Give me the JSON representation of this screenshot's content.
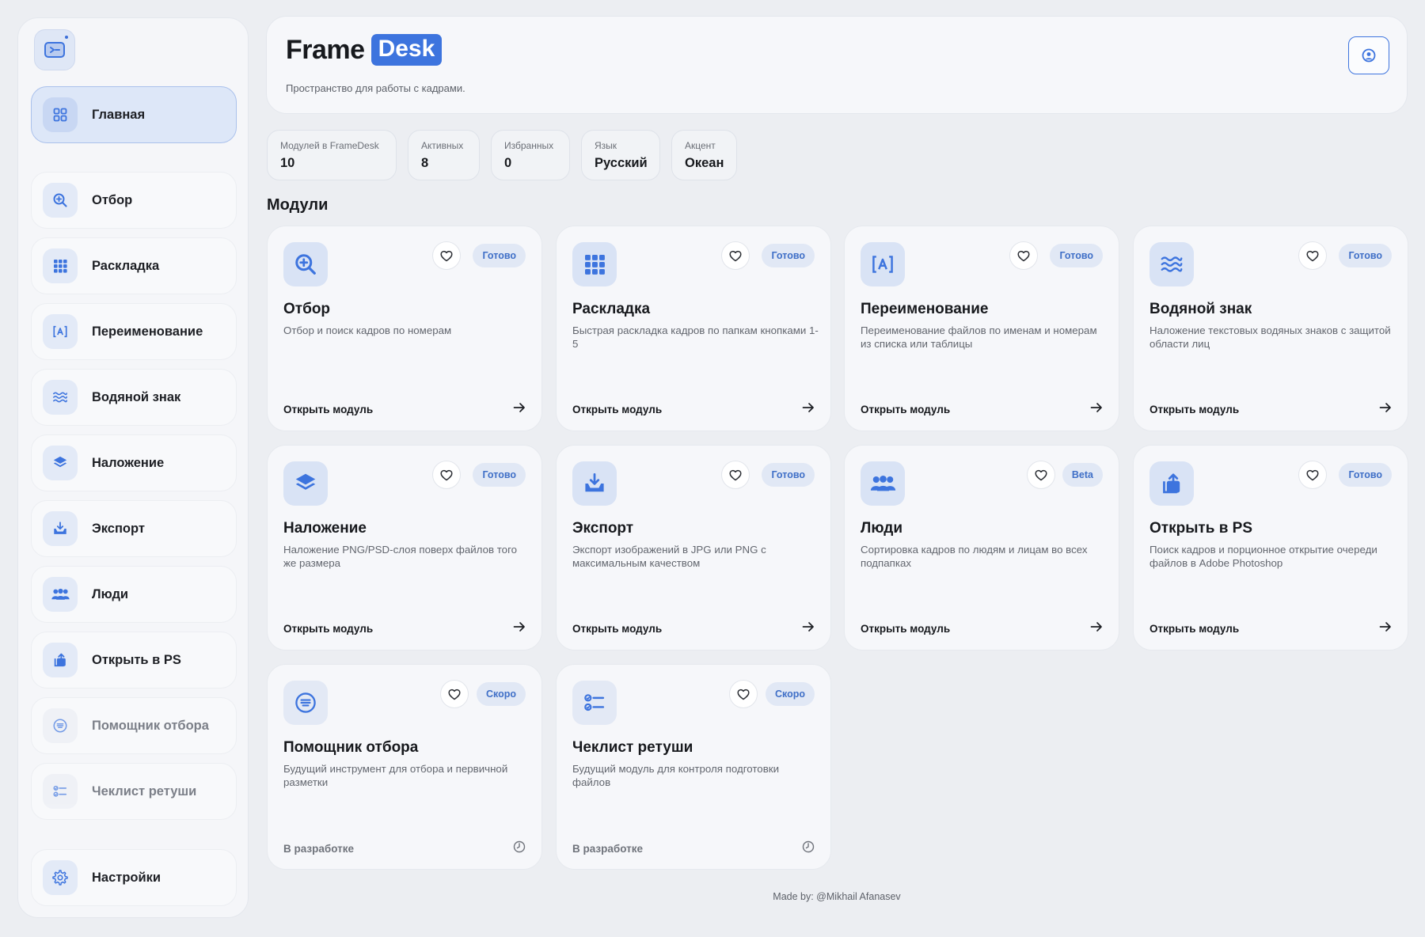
{
  "brand": {
    "word": "Frame",
    "badge": "Desk"
  },
  "header": {
    "subtitle": "Пространство для работы с кадрами."
  },
  "accent_color": "#3d74de",
  "sidebar": {
    "items": [
      {
        "label": "Главная",
        "icon": "grid-icon",
        "active": true
      },
      {
        "label": "Отбор",
        "icon": "zoom-in-icon"
      },
      {
        "label": "Раскладка",
        "icon": "dots-grid-icon"
      },
      {
        "label": "Переименование",
        "icon": "rename-icon"
      },
      {
        "label": "Водяной знак",
        "icon": "waves-icon"
      },
      {
        "label": "Наложение",
        "icon": "layers-icon"
      },
      {
        "label": "Экспорт",
        "icon": "export-tray-icon"
      },
      {
        "label": "Люди",
        "icon": "people-icon"
      },
      {
        "label": "Открыть в PS",
        "icon": "open-external-icon"
      },
      {
        "label": "Помощник отбора",
        "icon": "list-circle-icon",
        "disabled": true
      },
      {
        "label": "Чеклист ретуши",
        "icon": "checklist-icon",
        "disabled": true
      },
      {
        "label": "Настройки",
        "icon": "gear-icon"
      }
    ]
  },
  "stats": [
    {
      "label": "Модулей в FrameDesk",
      "value": "10"
    },
    {
      "label": "Активных",
      "value": "8"
    },
    {
      "label": "Избранных",
      "value": "0"
    },
    {
      "label": "Язык",
      "value": "Русский"
    },
    {
      "label": "Акцент",
      "value": "Океан"
    }
  ],
  "modules_title": "Модули",
  "modules": [
    {
      "title": "Отбор",
      "desc": "Отбор и поиск кадров по номерам",
      "badge": "Готово",
      "foot": "Открыть модуль",
      "icon": "zoom-in-icon"
    },
    {
      "title": "Раскладка",
      "desc": "Быстрая раскладка кадров по папкам кнопками 1-5",
      "badge": "Готово",
      "foot": "Открыть модуль",
      "icon": "dots-grid-icon"
    },
    {
      "title": "Переименование",
      "desc": "Переименование файлов по именам и номерам из списка или таблицы",
      "badge": "Готово",
      "foot": "Открыть модуль",
      "icon": "rename-icon"
    },
    {
      "title": "Водяной знак",
      "desc": "Наложение текстовых водяных знаков с защитой области лиц",
      "badge": "Готово",
      "foot": "Открыть модуль",
      "icon": "waves-icon"
    },
    {
      "title": "Наложение",
      "desc": "Наложение PNG/PSD-слоя поверх файлов того же размера",
      "badge": "Готово",
      "foot": "Открыть модуль",
      "icon": "layers-icon"
    },
    {
      "title": "Экспорт",
      "desc": "Экспорт изображений в JPG или PNG с максимальным качеством",
      "badge": "Готово",
      "foot": "Открыть модуль",
      "icon": "export-tray-icon"
    },
    {
      "title": "Люди",
      "desc": "Сортировка кадров по людям и лицам во всех подпапках",
      "badge": "Beta",
      "foot": "Открыть модуль",
      "icon": "people-icon"
    },
    {
      "title": "Открыть в PS",
      "desc": "Поиск кадров и порционное открытие очереди файлов в Adobe Photoshop",
      "badge": "Готово",
      "foot": "Открыть модуль",
      "icon": "open-external-icon"
    },
    {
      "title": "Помощник отбора",
      "desc": "Будущий инструмент для отбора и первичной разметки",
      "badge": "Скоро",
      "foot": "В разработке",
      "icon": "list-circle-icon",
      "soon": true
    },
    {
      "title": "Чеклист ретуши",
      "desc": "Будущий модуль для контроля подготовки файлов",
      "badge": "Скоро",
      "foot": "В разработке",
      "icon": "checklist-icon",
      "soon": true
    }
  ],
  "footer": "Made by: @Mikhail Afanasev"
}
